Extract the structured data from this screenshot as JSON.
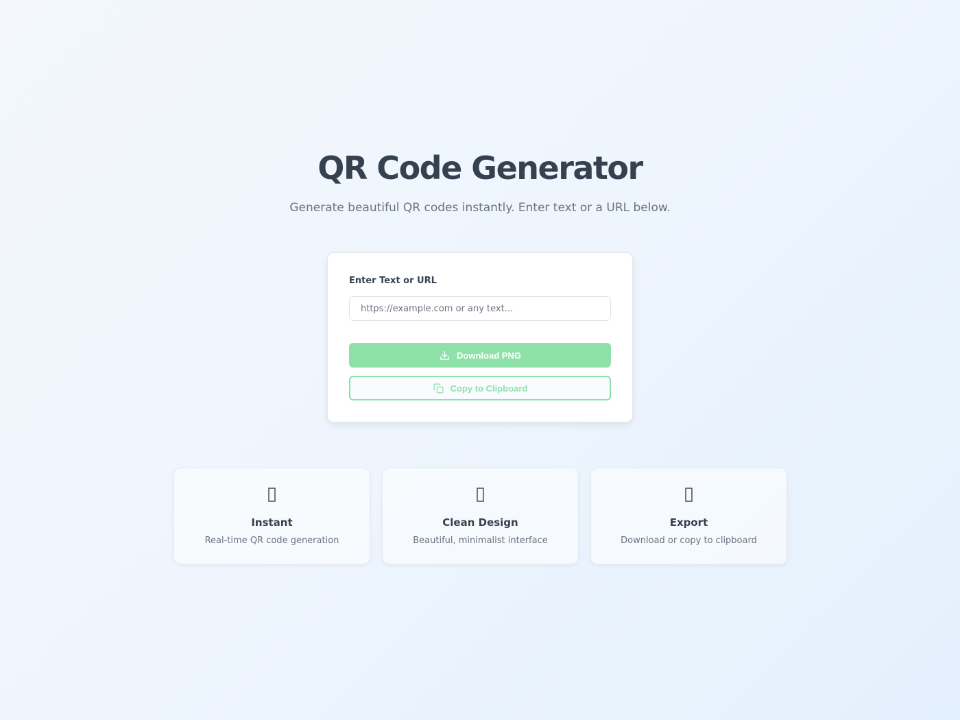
{
  "header": {
    "title": "QR Code Generator",
    "subtitle": "Generate beautiful QR codes instantly. Enter text or a URL below."
  },
  "form": {
    "label": "Enter Text or URL",
    "input_value": "",
    "input_placeholder": "https://example.com or any text...",
    "download_label": "Download PNG",
    "copy_label": "Copy to Clipboard",
    "download_icon": "download-icon",
    "copy_icon": "copy-icon"
  },
  "features": [
    {
      "icon": "missing-glyph-icon",
      "title": "Instant",
      "description": "Real-time QR code generation"
    },
    {
      "icon": "missing-glyph-icon",
      "title": "Clean Design",
      "description": "Beautiful, minimalist interface"
    },
    {
      "icon": "missing-glyph-icon",
      "title": "Export",
      "description": "Download or copy to clipboard"
    }
  ],
  "colors": {
    "accent": "#8ee1a9",
    "title": "#364150",
    "muted": "#6b7280",
    "card_bg": "#ffffff"
  }
}
